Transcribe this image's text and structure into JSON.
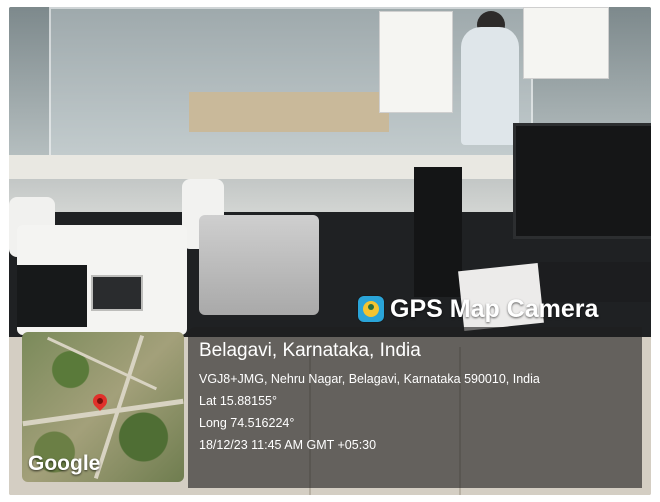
{
  "overlay": {
    "app_name": "GPS Map Camera",
    "location_title": "Belagavi, Karnataka, India",
    "address": "VGJ8+JMG, Nehru Nagar, Belagavi, Karnataka 590010, India",
    "latitude": "Lat 15.88155°",
    "longitude": "Long 74.516224°",
    "datetime": "18/12/23 11:45 AM GMT +05:30",
    "map_logo": "Google"
  },
  "icons": {
    "app_icon": "gps-map-camera-icon",
    "map_pin": "map-pin-icon"
  },
  "colors": {
    "overlay_text": "#ffffff",
    "panel": "rgba(30,30,30,0.62)",
    "pin": "#e0312b"
  }
}
